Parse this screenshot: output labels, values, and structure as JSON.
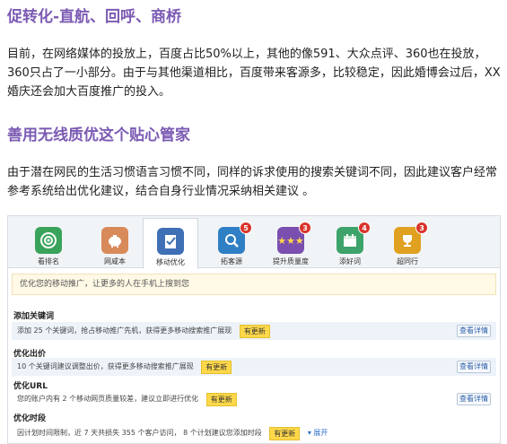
{
  "heading1": "促转化-直航、回呼、商桥",
  "paragraph1": "目前，在网络媒体的投放上，百度占比50%以上，其他的像591、大众点评、360也在投放，360只占了一小部分。由于与其他渠道相比，百度带来客源多，比较稳定，因此婚博会过后，XX婚庆还会加大百度推广的投入。",
  "heading2": "善用无线质优这个贴心管家",
  "paragraph2": "由于潜在网民的生活习惯语言习惯不同，同样的诉求使用的搜索关键词不同，因此建议客户经常参考系统给出优化建议，结合自身行业情况采纳相关建议 。",
  "tabs": [
    {
      "label": "看排名",
      "icon": "target-icon",
      "color": "#3aa35b",
      "badge": ""
    },
    {
      "label": "网咸本",
      "icon": "piggy-bank-icon",
      "color": "#d98a5a",
      "badge": ""
    },
    {
      "label": "移动优化",
      "icon": "check-list-icon",
      "color": "#3f6fb5",
      "badge": ""
    },
    {
      "label": "拓客源",
      "icon": "search-icon",
      "color": "#2f7fc4",
      "badge": "5"
    },
    {
      "label": "提升质量度",
      "icon": "stars-icon",
      "color": "#7a4fb0",
      "badge": "3"
    },
    {
      "label": "添好词",
      "icon": "calendar-icon",
      "color": "#3da36a",
      "badge": "4"
    },
    {
      "label": "超同行",
      "icon": "trophy-icon",
      "color": "#e0a020",
      "badge": "3"
    }
  ],
  "notice": "优化您的移动推广，让更多的人在手机上搜到您",
  "sections": [
    {
      "title": "添加关键词",
      "text": "添加  25 个关键词，抢占移动推广先机，获得更多移动搜索推广展现",
      "tag": "有更新",
      "button": "查看详情",
      "expand": ""
    },
    {
      "title": "优化出价",
      "text": "10 个关键词建议调整出价，获得更多移动搜索推广展现",
      "tag": "有更新",
      "button": "查看详情",
      "expand": ""
    },
    {
      "title": "优化URL",
      "text": "您的账户内有 2 个移动网页质量较差，建议立即进行优化",
      "tag": "有更新",
      "button": "查看详情",
      "expand": ""
    },
    {
      "title": "优化时段",
      "text": "因计划时间限制，近 7 天共损失 355 个客户访问， 8 个计划建议您添加时段",
      "tag": "有更新",
      "button": "",
      "expand": "▾ 展开"
    }
  ]
}
